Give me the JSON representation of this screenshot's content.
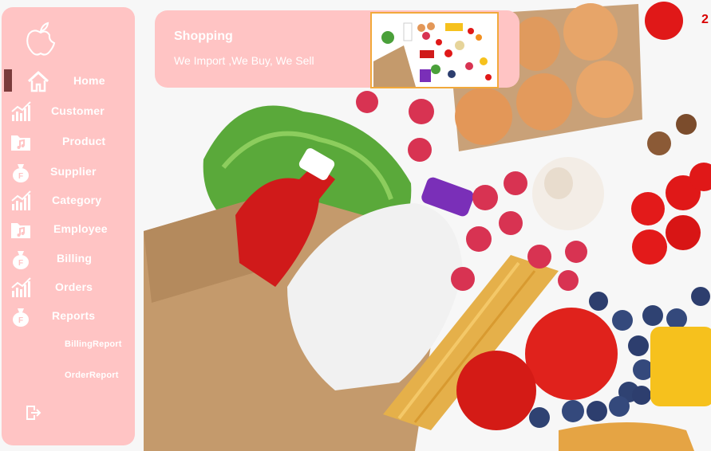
{
  "sidebar": {
    "logo": "apple-logo",
    "items": [
      {
        "label": "Home",
        "icon": "home-icon"
      },
      {
        "label": "Customer",
        "icon": "chart-icon"
      },
      {
        "label": "Product",
        "icon": "music-folder-icon"
      },
      {
        "label": "Supplier",
        "icon": "money-bag-icon"
      },
      {
        "label": "Category",
        "icon": "chart-icon"
      },
      {
        "label": "Employee",
        "icon": "music-folder-icon"
      },
      {
        "label": "Billing",
        "icon": "money-bag-icon"
      },
      {
        "label": "Orders",
        "icon": "chart-icon"
      },
      {
        "label": "Reports",
        "icon": "money-bag-icon"
      },
      {
        "label": "BillingReport"
      },
      {
        "label": "OrderReport"
      }
    ],
    "logout_icon": "logout-icon"
  },
  "header": {
    "title": "Shopping",
    "tagline": "We Import ,We Buy, We Sell"
  },
  "corner_number": "2",
  "colors": {
    "panel": "#ffc4c4",
    "active": "#7a3b3b",
    "accent_text": "#d90000"
  }
}
